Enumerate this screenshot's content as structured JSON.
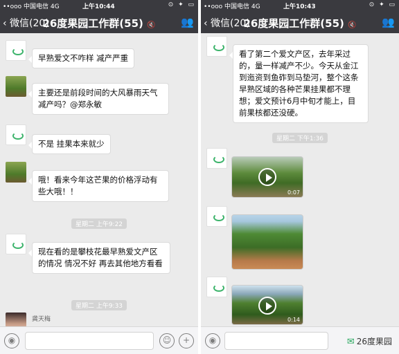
{
  "left": {
    "status": {
      "carrier": "••ooo 中国电信  4G",
      "time": "上午10:44",
      "icons": "⊙ ✦ ▭"
    },
    "nav": {
      "back": "‹ 微信(20)",
      "title": "26度果园工作群(55)",
      "mute": "🔇"
    },
    "messages": [
      {
        "text": "早熟爱文不咋样 减产严重"
      },
      {
        "text": "主要还是前段时间的大风暴雨天气减产吗？@郑永敏"
      },
      {
        "text": "不是 挂果本来就少"
      },
      {
        "text": "哦！看来今年这芒果的价格浮动有些大哦！！"
      },
      {
        "text": "现在看的是攀枝花最早熟爱文产区的情况 情况不好 再去其他地方看看"
      }
    ],
    "timestamps": [
      "星期二 上午9:22",
      "星期二 上午9:33"
    ],
    "last_sender": "龚天梅"
  },
  "right": {
    "status": {
      "carrier": "••ooo 中国电信  4G",
      "time": "上午10:43",
      "icons": "⊙ ✦ ▭"
    },
    "nav": {
      "back": "‹ 微信(20)",
      "title": "26度果园工作群(55)",
      "mute": "🔇"
    },
    "messages": [
      {
        "text": "看了第二个爱文产区，去年采过的，量一样减产不少。今天从金江到迤资到鱼砟到马垫河，整个这条早熟区域的各种芒果挂果都不理想；爱文预计6月中旬才能上，目前果核都还没硬。"
      }
    ],
    "timestamps": [
      "星期二 下午1:36"
    ],
    "videos": [
      {
        "duration": "0:07"
      },
      {
        "duration": ""
      },
      {
        "duration": "0:14"
      }
    ],
    "watermark": "26度果园"
  }
}
